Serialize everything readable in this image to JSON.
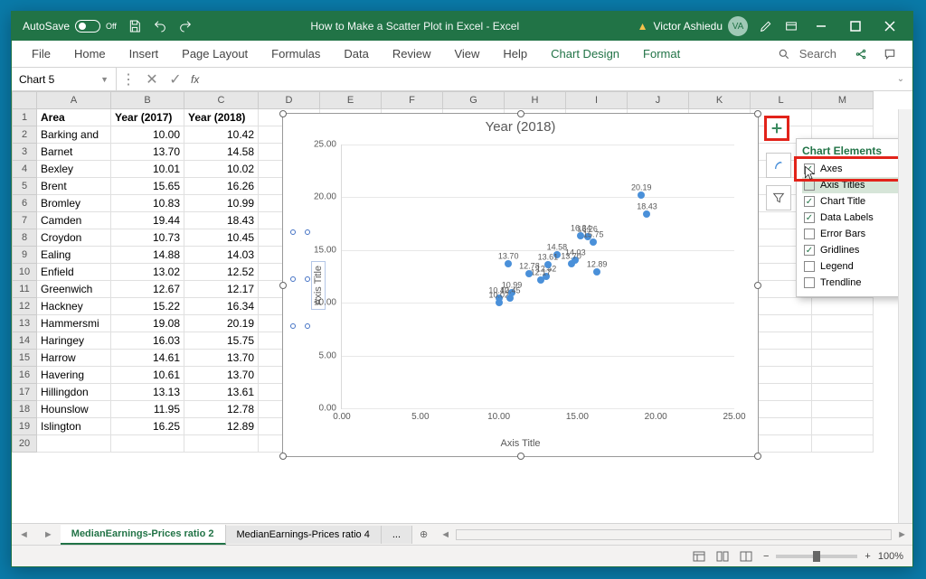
{
  "titlebar": {
    "autosave_label": "AutoSave",
    "autosave_state": "Off",
    "title": "How to Make a Scatter Plot in Excel  -  Excel",
    "user_name": "Victor Ashiedu",
    "user_initials": "VA"
  },
  "ribbon": {
    "tabs": [
      "File",
      "Home",
      "Insert",
      "Page Layout",
      "Formulas",
      "Data",
      "Review",
      "View",
      "Help",
      "Chart Design",
      "Format"
    ],
    "active_tabs": [
      "Chart Design",
      "Format"
    ],
    "search_label": "Search"
  },
  "formula_bar": {
    "name_box": "Chart 5"
  },
  "columns": [
    "A",
    "B",
    "C",
    "D",
    "E",
    "F",
    "G",
    "H",
    "I",
    "J",
    "K",
    "L",
    "M"
  ],
  "headers": {
    "A": "Area",
    "B": "Year (2017)",
    "C": "Year (2018)"
  },
  "rows": [
    {
      "area": "Barking and",
      "y2017": "10.00",
      "y2018": "10.42"
    },
    {
      "area": "Barnet",
      "y2017": "13.70",
      "y2018": "14.58"
    },
    {
      "area": "Bexley",
      "y2017": "10.01",
      "y2018": "10.02"
    },
    {
      "area": "Brent",
      "y2017": "15.65",
      "y2018": "16.26"
    },
    {
      "area": "Bromley",
      "y2017": "10.83",
      "y2018": "10.99"
    },
    {
      "area": "Camden",
      "y2017": "19.44",
      "y2018": "18.43"
    },
    {
      "area": "Croydon",
      "y2017": "10.73",
      "y2018": "10.45"
    },
    {
      "area": "Ealing",
      "y2017": "14.88",
      "y2018": "14.03"
    },
    {
      "area": "Enfield",
      "y2017": "13.02",
      "y2018": "12.52"
    },
    {
      "area": "Greenwich",
      "y2017": "12.67",
      "y2018": "12.17"
    },
    {
      "area": "Hackney",
      "y2017": "15.22",
      "y2018": "16.34"
    },
    {
      "area": "Hammersmi",
      "y2017": "19.08",
      "y2018": "20.19"
    },
    {
      "area": "Haringey",
      "y2017": "16.03",
      "y2018": "15.75"
    },
    {
      "area": "Harrow",
      "y2017": "14.61",
      "y2018": "13.70"
    },
    {
      "area": "Havering",
      "y2017": "10.61",
      "y2018": "13.70"
    },
    {
      "area": "Hillingdon",
      "y2017": "13.13",
      "y2018": "13.61"
    },
    {
      "area": "Hounslow",
      "y2017": "11.95",
      "y2018": "12.78"
    },
    {
      "area": "Islington",
      "y2017": "16.25",
      "y2018": "12.89"
    }
  ],
  "chart_data": {
    "type": "scatter",
    "title": "Year (2018)",
    "xlabel": "Axis Title",
    "ylabel": "Axis Title",
    "xlim": [
      0,
      25
    ],
    "x_ticks": [
      "0.00",
      "5.00",
      "10.00",
      "15.00",
      "20.00",
      "25.00"
    ],
    "ylim": [
      0,
      25
    ],
    "y_ticks": [
      "0.00",
      "5.00",
      "10.00",
      "15.00",
      "20.00",
      "25.00"
    ],
    "series": [
      {
        "name": "Year (2018)",
        "points": [
          {
            "x": 10.0,
            "y": 10.42,
            "label": "10.42"
          },
          {
            "x": 13.7,
            "y": 14.58,
            "label": "14.58"
          },
          {
            "x": 10.01,
            "y": 10.02,
            "label": "10.02"
          },
          {
            "x": 15.65,
            "y": 16.26,
            "label": "16.26"
          },
          {
            "x": 10.83,
            "y": 10.99,
            "label": "10.99"
          },
          {
            "x": 19.44,
            "y": 18.43,
            "label": "18.43"
          },
          {
            "x": 10.73,
            "y": 10.45,
            "label": "10.45"
          },
          {
            "x": 14.88,
            "y": 14.03,
            "label": "14.03"
          },
          {
            "x": 13.02,
            "y": 12.52,
            "label": "12.52"
          },
          {
            "x": 12.67,
            "y": 12.17,
            "label": "12.17"
          },
          {
            "x": 15.22,
            "y": 16.34,
            "label": "16.34"
          },
          {
            "x": 19.08,
            "y": 20.19,
            "label": "20.19"
          },
          {
            "x": 16.03,
            "y": 15.75,
            "label": "15.75"
          },
          {
            "x": 14.61,
            "y": 13.7,
            "label": "13.70"
          },
          {
            "x": 10.61,
            "y": 13.7,
            "label": "13.70"
          },
          {
            "x": 13.13,
            "y": 13.61,
            "label": "13.61"
          },
          {
            "x": 11.95,
            "y": 12.78,
            "label": "12.78"
          },
          {
            "x": 16.25,
            "y": 12.89,
            "label": "12.89"
          }
        ]
      }
    ]
  },
  "chart_elements": {
    "title": "Chart Elements",
    "items": [
      {
        "label": "Axes",
        "checked": true
      },
      {
        "label": "Axis Titles",
        "checked": false,
        "hover": true,
        "arrow": true
      },
      {
        "label": "Chart Title",
        "checked": true
      },
      {
        "label": "Data Labels",
        "checked": true
      },
      {
        "label": "Error Bars",
        "checked": false
      },
      {
        "label": "Gridlines",
        "checked": true
      },
      {
        "label": "Legend",
        "checked": false
      },
      {
        "label": "Trendline",
        "checked": false
      }
    ]
  },
  "sheet_tabs": {
    "tabs": [
      "MedianEarnings-Prices ratio 2",
      "MedianEarnings-Prices ratio 4"
    ],
    "active": 0,
    "more": "..."
  },
  "statusbar": {
    "zoom": "100%"
  }
}
